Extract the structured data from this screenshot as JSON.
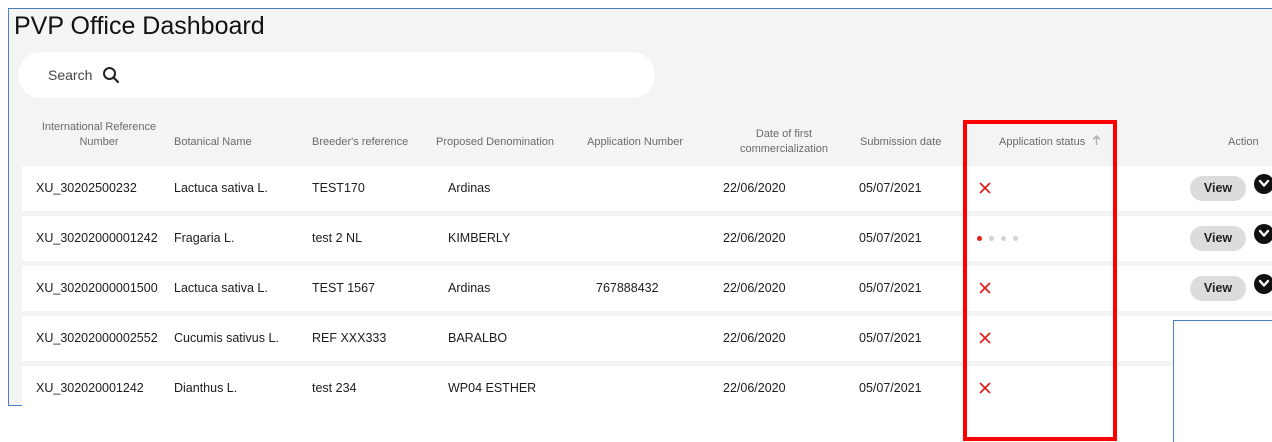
{
  "page": {
    "title": "PVP Office Dashboard"
  },
  "search": {
    "placeholder": "Search"
  },
  "table": {
    "headers": {
      "intl_ref": "International Reference Number",
      "botanical": "Botanical Name",
      "breeder": "Breeder's reference",
      "denomination": "Proposed Denomination",
      "app_number": "Application Number",
      "first_comm": "Date of first commercialization",
      "submission": "Submission date",
      "status": "Application status",
      "action": "Action"
    },
    "rows": [
      {
        "intl_ref": "XU_30202500232",
        "botanical": "Lactuca sativa L.",
        "breeder": "TEST170",
        "denomination": "Ardinas",
        "app_number": "",
        "first_comm": "22/06/2020",
        "submission": "05/07/2021",
        "status": "rejected",
        "action": "View"
      },
      {
        "intl_ref": "XU_30202000001242",
        "botanical": "Fragaria L.",
        "breeder": "test 2 NL",
        "denomination": "KIMBERLY",
        "app_number": "",
        "first_comm": "22/06/2020",
        "submission": "05/07/2021",
        "status": "in-progress",
        "progress_step": 1,
        "progress_total": 4,
        "action": "View"
      },
      {
        "intl_ref": "XU_30202000001500",
        "botanical": "Lactuca sativa L.",
        "breeder": "TEST 1567",
        "denomination": "Ardinas",
        "app_number": "767888432",
        "first_comm": "22/06/2020",
        "submission": "05/07/2021",
        "status": "rejected",
        "action": "View"
      },
      {
        "intl_ref": "XU_30202000002552",
        "botanical": "Cucumis sativus L.",
        "breeder": "REF XXX333",
        "denomination": "BARALBO",
        "app_number": "",
        "first_comm": "22/06/2020",
        "submission": "05/07/2021",
        "status": "rejected"
      },
      {
        "intl_ref": "XU_302020001242",
        "botanical": "Dianthus L.",
        "breeder": "test 234",
        "denomination": "WP04 ESTHER",
        "app_number": "",
        "first_comm": "22/06/2020",
        "submission": "05/07/2021",
        "status": "rejected"
      }
    ]
  },
  "colors": {
    "accent_red": "#e0201e",
    "highlight_border": "#ff0000",
    "panel_border": "#4a7fc0"
  },
  "icons": {
    "search": "search-icon",
    "sort": "arrow-up-icon",
    "rejected": "close-icon",
    "expand": "chevron-down-icon"
  }
}
